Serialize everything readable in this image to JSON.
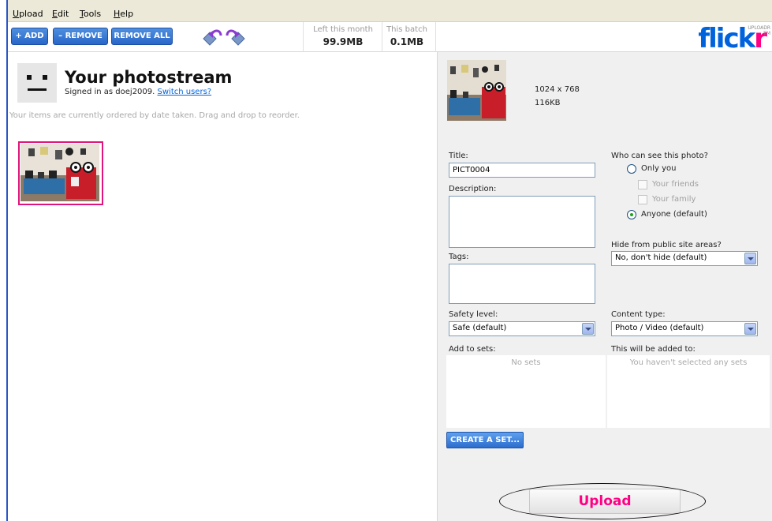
{
  "menu": [
    {
      "label": "Upload",
      "underline": "U",
      "rest": "pload"
    },
    {
      "label": "Edit",
      "underline": "E",
      "rest": "dit"
    },
    {
      "label": "Tools",
      "underline": "T",
      "rest": "ools"
    },
    {
      "label": "Help",
      "underline": "H",
      "rest": "elp"
    }
  ],
  "toolbar": {
    "add_label": "+ ADD",
    "remove_label": "– REMOVE",
    "remove_all_label": "REMOVE ALL",
    "left_month_label": "Left this month",
    "left_month_value": "99.9MB",
    "batch_label": "This batch",
    "batch_value": "0.1MB"
  },
  "logo": {
    "part1": "flick",
    "part2": "r",
    "sub": "UPLOADR",
    "tm": "TM"
  },
  "photostream": {
    "title": "Your photostream",
    "signed_in_prefix": "Signed in as doej2009.",
    "switch_users": "Switch users?",
    "hint": "Your items are currently ordered by date taken. Drag and drop to reorder."
  },
  "preview": {
    "dimensions": "1024 x 768",
    "size": "116KB"
  },
  "form": {
    "title_label": "Title:",
    "title_value": "PICT0004",
    "description_label": "Description:",
    "tags_label": "Tags:",
    "safety_label": "Safety level:",
    "safety_value": "Safe (default)",
    "add_sets_label": "Add to sets:",
    "no_sets": "No sets",
    "who_label": "Who can see this photo?",
    "only_you": "Only you",
    "friends": "Your friends",
    "family": "Your family",
    "anyone": "Anyone (default)",
    "hide_label": "Hide from public site areas?",
    "hide_value": "No, don't hide (default)",
    "content_label": "Content type:",
    "content_value": "Photo / Video (default)",
    "added_to_label": "This will be added to:",
    "added_to_empty": "You haven't selected any sets",
    "create_set": "CREATE A SET...",
    "upload": "Upload"
  },
  "colors": {
    "accent_blue": "#0063dc",
    "accent_pink": "#ff0084",
    "button_blue": "#2866c8"
  }
}
